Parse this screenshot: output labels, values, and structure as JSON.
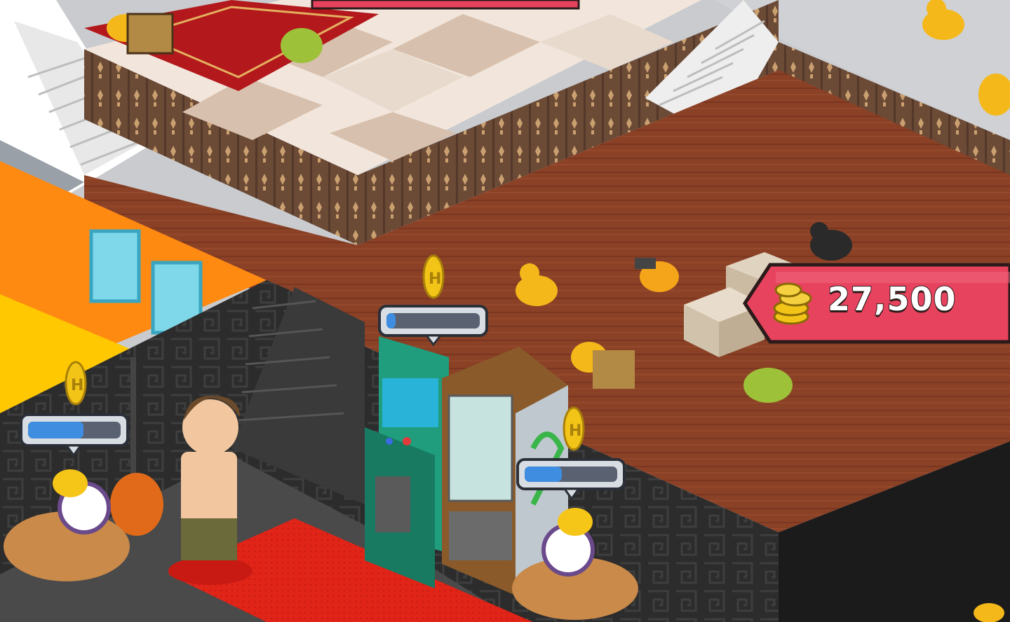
{
  "game": {
    "price": "27,500",
    "currency_icon": "gold-coins-icon",
    "progress_bars": [
      {
        "id": "left",
        "fill": 0.6
      },
      {
        "id": "arcade",
        "fill": 0.1
      },
      {
        "id": "vending",
        "fill": 0.4
      }
    ],
    "colors": {
      "price_tag": "#e8435e",
      "progress_fill": "#3f8de0",
      "wood_floor": "#8c4328",
      "red_carpet": "#e02418",
      "orange_wall": "#ff8a12"
    }
  }
}
